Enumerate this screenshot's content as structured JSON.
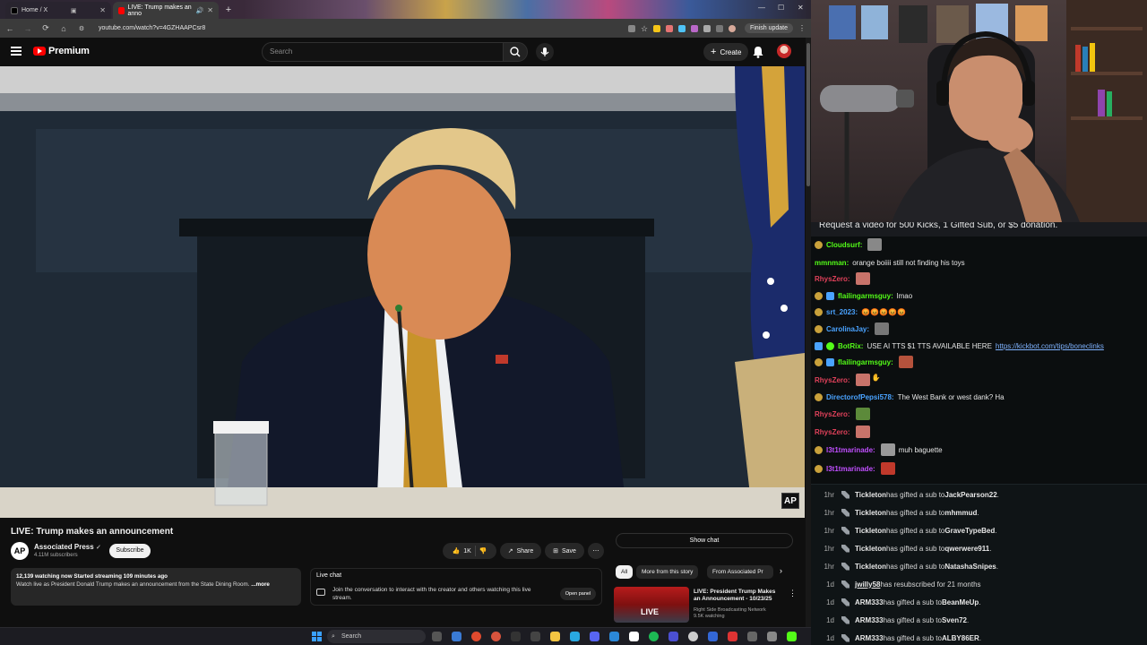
{
  "browser": {
    "tabs": [
      {
        "label": "Home / X",
        "active": false
      },
      {
        "label": "LIVE: Trump makes an anno",
        "active": true
      }
    ],
    "url": "youtube.com/watch?v=4GZHAAPCsr8",
    "finish_update": "Finish update"
  },
  "youtube": {
    "logo_text": "Premium",
    "search_placeholder": "Search",
    "create_label": "Create",
    "video": {
      "title": "LIVE: Trump makes an announcement",
      "watermark": "AP"
    },
    "channel": {
      "avatar_text": "AP",
      "name": "Associated Press",
      "subscribers": "4.11M subscribers",
      "subscribe_label": "Subscribe"
    },
    "actions": {
      "likes": "1K",
      "share": "Share",
      "save": "Save",
      "more": "⋯"
    },
    "description": {
      "stats": "12,139 watching now  Started streaming 109 minutes ago",
      "text": "Watch live as President Donald Trump makes an announcement from the State Dining Room. ",
      "more": "...more"
    },
    "live_chat": {
      "title": "Live chat",
      "text": "Join the conversation to interact with the creator and others watching this live stream.",
      "open_panel": "Open panel"
    },
    "show_chat": "Show chat",
    "chips": [
      "All",
      "More from this story",
      "From Associated Pr"
    ],
    "recommendation": {
      "badge": "LIVE",
      "title": "LIVE: President Trump Makes an Announcement - 10/23/25",
      "channel": "Right Side Broadcasting Network",
      "watching": "9.5K watching"
    }
  },
  "taskbar": {
    "search_label": "Search"
  },
  "chat": {
    "pinned": "Request a video for 500 Kicks, 1 Gifted Sub, or $5 donation.",
    "messages": [
      {
        "user": "Cloudsurf:",
        "text": "",
        "color": "#53fc18"
      },
      {
        "user": "mmnman:",
        "text": "orange boiiii still not finding his toys",
        "color": "#53fc18"
      },
      {
        "user": "RhysZero:",
        "text": "",
        "color": "#e0415a"
      },
      {
        "user": "flailingarmsguy:",
        "text": "lmao",
        "color": "#53fc18"
      },
      {
        "user": "srt_2023:",
        "text": "😡😡😡😡😡",
        "color": "#4aa3ff"
      },
      {
        "user": "CarolinaJay:",
        "text": "",
        "color": "#4aa3ff"
      },
      {
        "user": "BotRix:",
        "text": "USE AI TTS $1 TTS AVAILABLE HERE",
        "link": "https://kickbot.com/tips/boneclinks",
        "color": "#53fc18"
      },
      {
        "user": "flailingarmsguy:",
        "text": "",
        "color": "#53fc18"
      },
      {
        "user": "RhysZero:",
        "text": "",
        "color": "#e0415a"
      },
      {
        "user": "DirectorofPepsi578:",
        "text": "The West Bank or west dank? Ha",
        "color": "#4aa3ff"
      },
      {
        "user": "RhysZero:",
        "text": "",
        "color": "#e0415a"
      },
      {
        "user": "RhysZero:",
        "text": "",
        "color": "#e0415a"
      },
      {
        "user": "l3t1tmarinade:",
        "text": "muh baguette",
        "color": "#c04fff"
      },
      {
        "user": "l3t1tmarinade:",
        "text": "",
        "color": "#c04fff"
      }
    ],
    "subs": [
      {
        "time": "1hr",
        "text_before": "Tickleton",
        "middle": " has gifted a sub to ",
        "target": "JackPearson22",
        "end": "."
      },
      {
        "time": "1hr",
        "text_before": "Tickleton",
        "middle": " has gifted a sub to ",
        "target": "mhmmud",
        "end": "."
      },
      {
        "time": "1hr",
        "text_before": "Tickleton",
        "middle": " has gifted a sub to ",
        "target": "GraveTypeBed",
        "end": "."
      },
      {
        "time": "1hr",
        "text_before": "Tickleton",
        "middle": " has gifted a sub to ",
        "target": "qwerwere911",
        "end": "."
      },
      {
        "time": "1hr",
        "text_before": "Tickleton",
        "middle": " has gifted a sub to ",
        "target": "NatashaSnipes",
        "end": "."
      },
      {
        "time": "1d",
        "text_before": "jwilly58",
        "middle": " has resubscribed for 21 months",
        "target": "",
        "end": ""
      },
      {
        "time": "1d",
        "text_before": "ARM333",
        "middle": " has gifted a sub to ",
        "target": "BeanMeUp",
        "end": "."
      },
      {
        "time": "1d",
        "text_before": "ARM333",
        "middle": " has gifted a sub to ",
        "target": "Sven72",
        "end": "."
      },
      {
        "time": "1d",
        "text_before": "ARM333",
        "middle": " has gifted a sub to ",
        "target": "ALBY86ER",
        "end": "."
      }
    ]
  }
}
